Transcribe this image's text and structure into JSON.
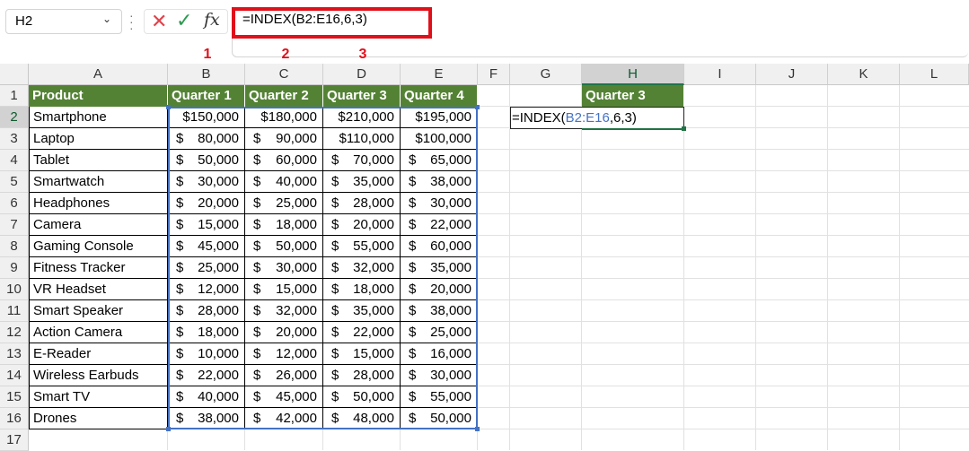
{
  "name_box": "H2",
  "formula_bar": {
    "formula": "=INDEX(B2:E16,6,3)",
    "fx_label": "fx"
  },
  "annotations": [
    "1",
    "2",
    "3"
  ],
  "columns": [
    "A",
    "B",
    "C",
    "D",
    "E",
    "F",
    "G",
    "H",
    "I",
    "J",
    "K",
    "L"
  ],
  "rows": [
    "1",
    "2",
    "3",
    "4",
    "5",
    "6",
    "7",
    "8",
    "9",
    "10",
    "11",
    "12",
    "13",
    "14",
    "15",
    "16",
    "17"
  ],
  "table": {
    "headers": [
      "Product",
      "Quarter 1",
      "Quarter 2",
      "Quarter 3",
      "Quarter 4"
    ],
    "rows": [
      [
        "Smartphone",
        "$150,000",
        "$180,000",
        "$210,000",
        "$195,000"
      ],
      [
        "Laptop",
        "80,000",
        "90,000",
        "$110,000",
        "$100,000"
      ],
      [
        "Tablet",
        "50,000",
        "60,000",
        "70,000",
        "65,000"
      ],
      [
        "Smartwatch",
        "30,000",
        "40,000",
        "35,000",
        "38,000"
      ],
      [
        "Headphones",
        "20,000",
        "25,000",
        "28,000",
        "30,000"
      ],
      [
        "Camera",
        "15,000",
        "18,000",
        "20,000",
        "22,000"
      ],
      [
        "Gaming Console",
        "45,000",
        "50,000",
        "55,000",
        "60,000"
      ],
      [
        "Fitness Tracker",
        "25,000",
        "30,000",
        "32,000",
        "35,000"
      ],
      [
        "VR Headset",
        "12,000",
        "15,000",
        "18,000",
        "20,000"
      ],
      [
        "Smart Speaker",
        "28,000",
        "32,000",
        "35,000",
        "38,000"
      ],
      [
        "Action Camera",
        "18,000",
        "20,000",
        "22,000",
        "25,000"
      ],
      [
        "E-Reader",
        "10,000",
        "12,000",
        "15,000",
        "16,000"
      ],
      [
        "Wireless Earbuds",
        "22,000",
        "26,000",
        "28,000",
        "30,000"
      ],
      [
        "Smart TV",
        "40,000",
        "45,000",
        "50,000",
        "55,000"
      ],
      [
        "Drones",
        "38,000",
        "42,000",
        "48,000",
        "50,000"
      ]
    ]
  },
  "result_header": "Quarter 3",
  "edit_cell": {
    "prefix": "=INDEX(",
    "range": "B2:E16",
    "suffix": ",6,3)"
  },
  "colors": {
    "header_fill": "#548235",
    "range_border": "#4472c4",
    "highlight": "#e0101b",
    "accent": "#217346"
  }
}
